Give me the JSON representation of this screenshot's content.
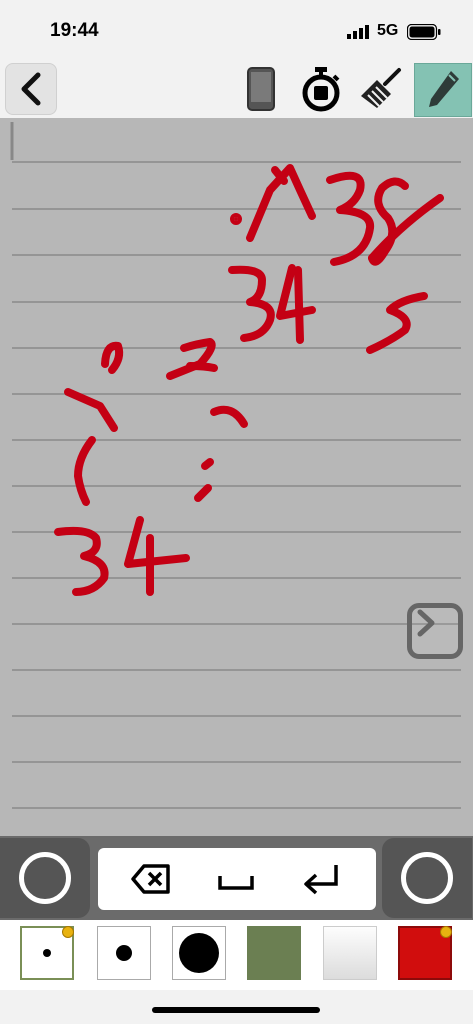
{
  "status_bar": {
    "time": "19:44",
    "network": "5G"
  },
  "toolbar": {
    "back": "back-arrow-icon",
    "tools": [
      "phone-device-icon",
      "stopwatch-icon",
      "broom-clear-icon",
      "pencil-icon"
    ],
    "active_tool": "pencil-icon"
  },
  "canvas": {
    "background": "#b7b7b7",
    "ink_color": "#c40014"
  },
  "input_bar": {
    "keys": [
      "backspace-icon",
      "space-icon",
      "enter-icon"
    ]
  },
  "palette": {
    "swatches": [
      "small-dot-pen",
      "medium-dot-pen",
      "large-dot-pen",
      "olive-green",
      "white",
      "red"
    ],
    "colors": {
      "green": "#6b7f52",
      "white": "#f0f0f0",
      "red": "#d10d0d"
    }
  }
}
